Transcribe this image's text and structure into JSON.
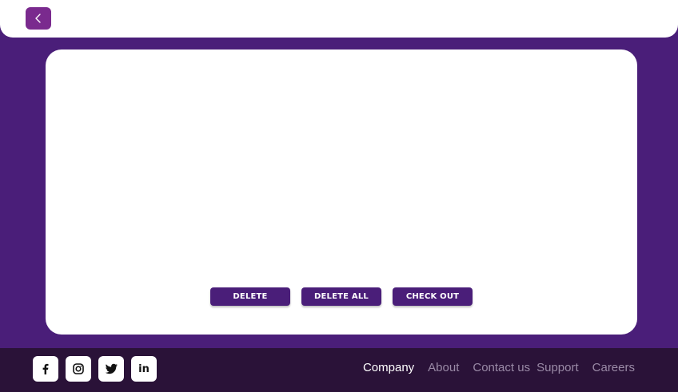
{
  "topbar": {
    "back_icon": "chevron-left-icon",
    "colors": {
      "background": "#ffffff",
      "back_button": "#7a2a8e"
    }
  },
  "main": {
    "actions": [
      {
        "label": "DELETE"
      },
      {
        "label": "DELETE ALL"
      },
      {
        "label": "CHECK OUT"
      }
    ],
    "colors": {
      "page_background": "#4a1e79",
      "card": "#ffffff",
      "button": "#4a1e79"
    }
  },
  "footer": {
    "socials": [
      {
        "icon": "facebook-icon"
      },
      {
        "icon": "instagram-icon"
      },
      {
        "icon": "twitter-icon"
      },
      {
        "icon": "linkedin-icon",
        "text": "in"
      }
    ],
    "links": [
      {
        "label": "Company"
      },
      {
        "label": "About"
      },
      {
        "label": "Contact us"
      },
      {
        "label": "Support"
      },
      {
        "label": "Careers"
      }
    ],
    "colors": {
      "background": "#2a1238",
      "active_link": "#ffffff",
      "link": "#9a8aa6"
    }
  }
}
